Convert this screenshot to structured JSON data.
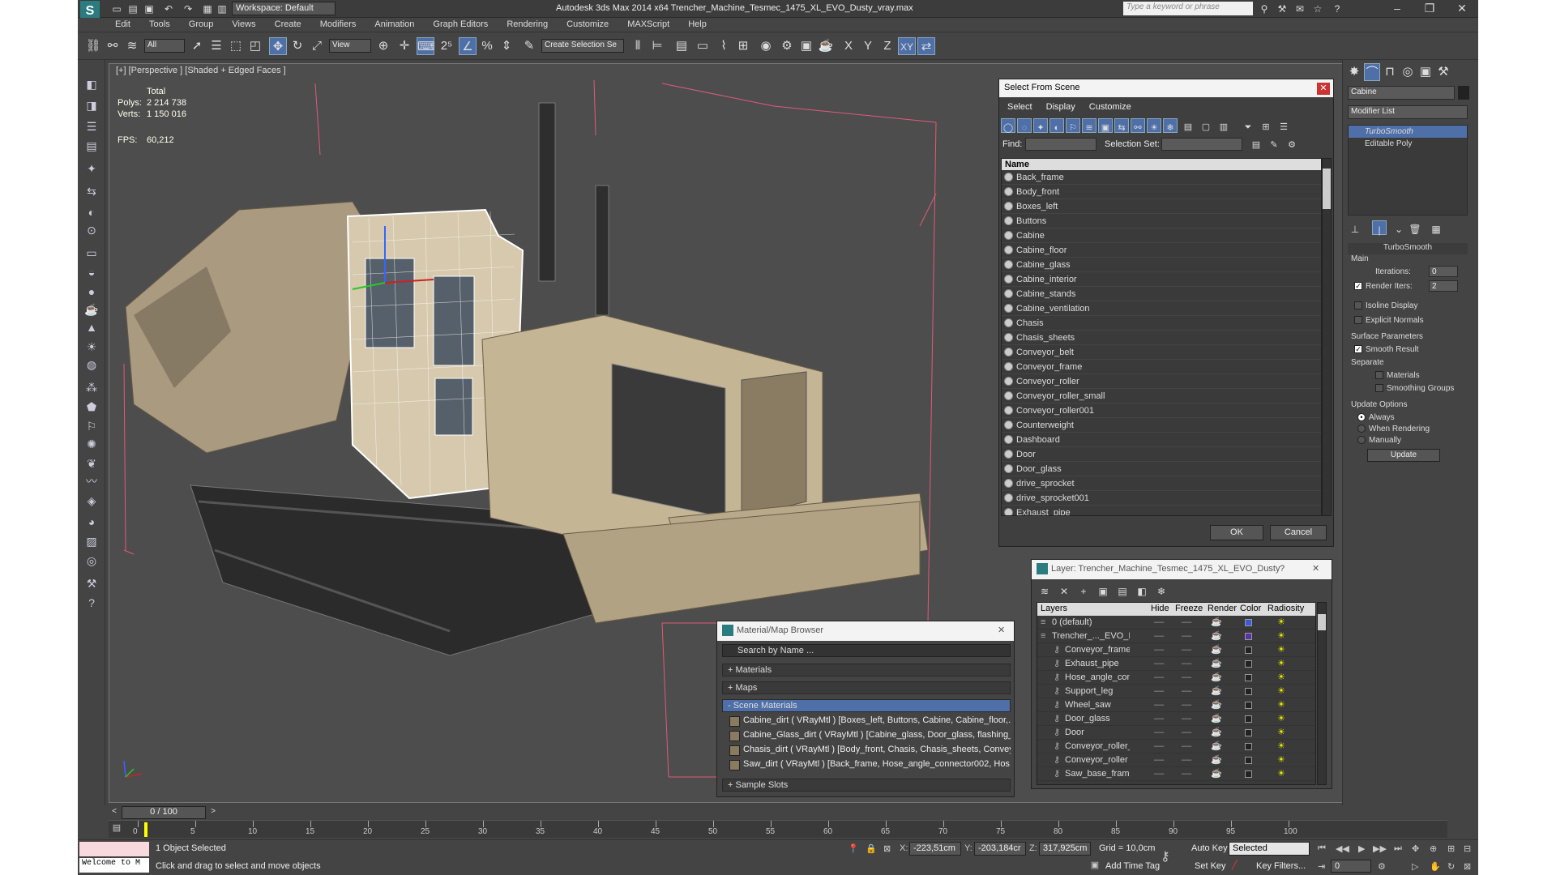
{
  "app": {
    "title": "Autodesk 3ds Max  2014 x64     Trencher_Machine_Tesmec_1475_XL_EVO_Dusty_vray.max",
    "logo": "3ds-max-logo",
    "workspace": "Workspace: Default",
    "search_placeholder": "Type a keyword or phrase"
  },
  "menu": [
    "Edit",
    "Tools",
    "Group",
    "Views",
    "Create",
    "Modifiers",
    "Animation",
    "Graph Editors",
    "Rendering",
    "Customize",
    "MAXScript",
    "Help"
  ],
  "toolbar": {
    "selection_filter": "All",
    "ref_coord": "View",
    "named_selection_placeholder": "Create Selection Se",
    "axis_labels": [
      "X",
      "Y",
      "Z",
      "XY"
    ]
  },
  "viewport": {
    "label": "[+] [Perspective ] [Shaded + Edged Faces ]",
    "stats_header": "Total",
    "polys_label": "Polys:",
    "polys": "2 214 738",
    "verts_label": "Verts:",
    "verts": "1 150 016",
    "fps_label": "FPS:",
    "fps": "60,212"
  },
  "command_panel": {
    "object_name": "Cabine",
    "modifier_list": "Modifier List",
    "stack": [
      "TurboSmooth",
      "Editable Poly"
    ],
    "rollout_title": "TurboSmooth",
    "main_label": "Main",
    "iterations_label": "Iterations:",
    "iterations": "0",
    "render_iters_label": "Render Iters:",
    "render_iters": "2",
    "isoline": "Isoline Display",
    "explicit": "Explicit Normals",
    "surface_params": "Surface Parameters",
    "smooth_result": "Smooth Result",
    "separate": "Separate",
    "materials": "Materials",
    "smoothing_groups": "Smoothing Groups",
    "update_options": "Update Options",
    "always": "Always",
    "when_rendering": "When Rendering",
    "manually": "Manually",
    "update_btn": "Update"
  },
  "select_dialog": {
    "title": "Select From Scene",
    "menu": [
      "Select",
      "Display",
      "Customize"
    ],
    "find_label": "Find:",
    "selection_set_label": "Selection Set:",
    "column": "Name",
    "items": [
      "Back_frame",
      "Body_front",
      "Boxes_left",
      "Buttons",
      "Cabine",
      "Cabine_floor",
      "Cabine_glass",
      "Cabine_interior",
      "Cabine_stands",
      "Cabine_ventilation",
      "Chasis",
      "Chasis_sheets",
      "Conveyor_belt",
      "Conveyor_frame",
      "Conveyor_roller",
      "Conveyor_roller_small",
      "Conveyor_roller001",
      "Counterweight",
      "Dashboard",
      "Door",
      "Door_glass",
      "drive_sprocket",
      "drive_sprocket001",
      "Exhaust_pipe"
    ],
    "ok": "OK",
    "cancel": "Cancel"
  },
  "layer_dialog": {
    "title": "Layer: Trencher_Machine_Tesmec_1475_XL_EVO_Dusty",
    "help": "?",
    "columns": [
      "Layers",
      "Hide",
      "Freeze",
      "Render",
      "Color",
      "Radiosity"
    ],
    "rows": [
      {
        "name": "0 (default)",
        "color": "#3a5bd9",
        "indent": 0
      },
      {
        "name": "Trencher_..._EVO_I",
        "color": "#5a32a8",
        "indent": 0
      },
      {
        "name": "Conveyor_frame",
        "color": "#222222",
        "indent": 1
      },
      {
        "name": "Exhaust_pipe",
        "color": "#222222",
        "indent": 1
      },
      {
        "name": "Hose_angle_con",
        "color": "#222222",
        "indent": 1
      },
      {
        "name": "Support_leg",
        "color": "#222222",
        "indent": 1
      },
      {
        "name": "Wheel_saw",
        "color": "#222222",
        "indent": 1
      },
      {
        "name": "Door_glass",
        "color": "#222222",
        "indent": 1
      },
      {
        "name": "Door",
        "color": "#222222",
        "indent": 1
      },
      {
        "name": "Conveyor_roller_",
        "color": "#222222",
        "indent": 1
      },
      {
        "name": "Conveyor_roller",
        "color": "#222222",
        "indent": 1
      },
      {
        "name": "Saw_base_frame",
        "color": "#222222",
        "indent": 1
      }
    ]
  },
  "material_browser": {
    "title": "Material/Map Browser",
    "search": "Search by Name ...",
    "materials": "+ Materials",
    "maps": "+ Maps",
    "scene_materials": "- Scene Materials",
    "sample_slots": "+ Sample Slots",
    "items": [
      "Cabine_dirt  ( VRayMtl ) [Boxes_left, Buttons, Cabine, Cabine_floor,...",
      "Cabine_Glass_dirt  ( VRayMtl ) [Cabine_glass, Door_glass, flashing_...",
      "Chasis_dirt  ( VRayMtl ) [Body_front, Chasis, Chasis_sheets, Convey...",
      "Saw_dirt  ( VRayMtl ) [Back_frame, Hose_angle_connector002, Hos..."
    ]
  },
  "timeline": {
    "frame": "0 / 100",
    "ticks": [
      "0",
      "5",
      "10",
      "15",
      "20",
      "25",
      "30",
      "35",
      "40",
      "45",
      "50",
      "55",
      "60",
      "65",
      "70",
      "75",
      "80",
      "85",
      "90",
      "95",
      "100"
    ]
  },
  "status": {
    "listener": "Welcome to M",
    "selected": "1 Object Selected",
    "prompt": "Click and drag to select and move objects",
    "x_label": "X:",
    "x": "-223,51cm",
    "y_label": "Y:",
    "y": "-203,184cr",
    "z_label": "Z:",
    "z": "317,925cm",
    "grid": "Grid = 10,0cm",
    "auto_key": "Auto Key",
    "set_key": "Set Key",
    "key_mode": "Selected",
    "key_filters": "Key Filters...",
    "add_time_tag": "Add Time Tag",
    "frame_field": "0"
  },
  "colors": {
    "accent": "#4f6fa8",
    "model": "#c8b89a",
    "wire": "#ffffff",
    "bounding": "#e05a7a"
  }
}
